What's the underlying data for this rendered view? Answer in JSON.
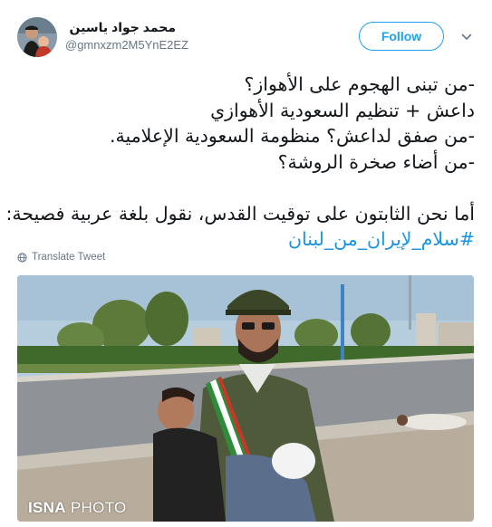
{
  "tweet": {
    "author": {
      "display_name": "محمد جواد یاسین",
      "handle": "@gmnxzm2M5YnE2EZ"
    },
    "follow_label": "Follow",
    "text_lines": [
      "-من تبنى الهجوم على الأهواز؟",
      "داعش + تنظيم السعودية الأهوازي",
      "-من صفق لداعش؟ منظومة السعودية الإعلامية.",
      "-من أضاء صخرة الروشة؟",
      "أما نحن الثابتون على توقيت القدس، نقول بلغة عربية فصيحة:"
    ],
    "hashtag": "#سلام_لإيران_من_لبنان",
    "translate_label": "Translate Tweet",
    "photo": {
      "watermark_bold": "ISNA",
      "watermark_light": " PHOTO"
    }
  },
  "colors": {
    "accent": "#1da1f2",
    "hashtag": "#1b95e0",
    "secondary_text": "#657786"
  },
  "icons": {
    "menu": "chevron-down-icon",
    "translate": "globe-icon"
  }
}
